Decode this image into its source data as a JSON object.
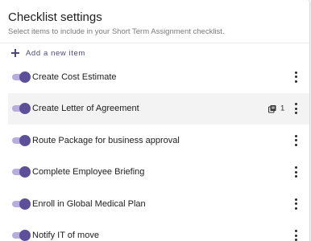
{
  "header": {
    "title": "Checklist settings",
    "subtitle": "Select items to include in your Short Term Assignment checklist."
  },
  "add_item": {
    "label": "Add a new item",
    "icon": "plus-icon"
  },
  "colors": {
    "accent": "#5e4f9a",
    "toggle_track": "#b7aedd",
    "highlight_row": "#f3f3f3"
  },
  "items": [
    {
      "label": "Create Cost Estimate",
      "enabled": true
    },
    {
      "label": "Create Letter of Agreement",
      "enabled": true,
      "attachment_count": "1",
      "attachment_icon": "document-copy-icon"
    },
    {
      "label": "Route Package for business approval",
      "enabled": true
    },
    {
      "label": "Complete Employee Briefing",
      "enabled": true
    },
    {
      "label": "Enroll in Global Medical Plan",
      "enabled": true
    },
    {
      "label": "Notify IT of move",
      "enabled": true
    }
  ]
}
